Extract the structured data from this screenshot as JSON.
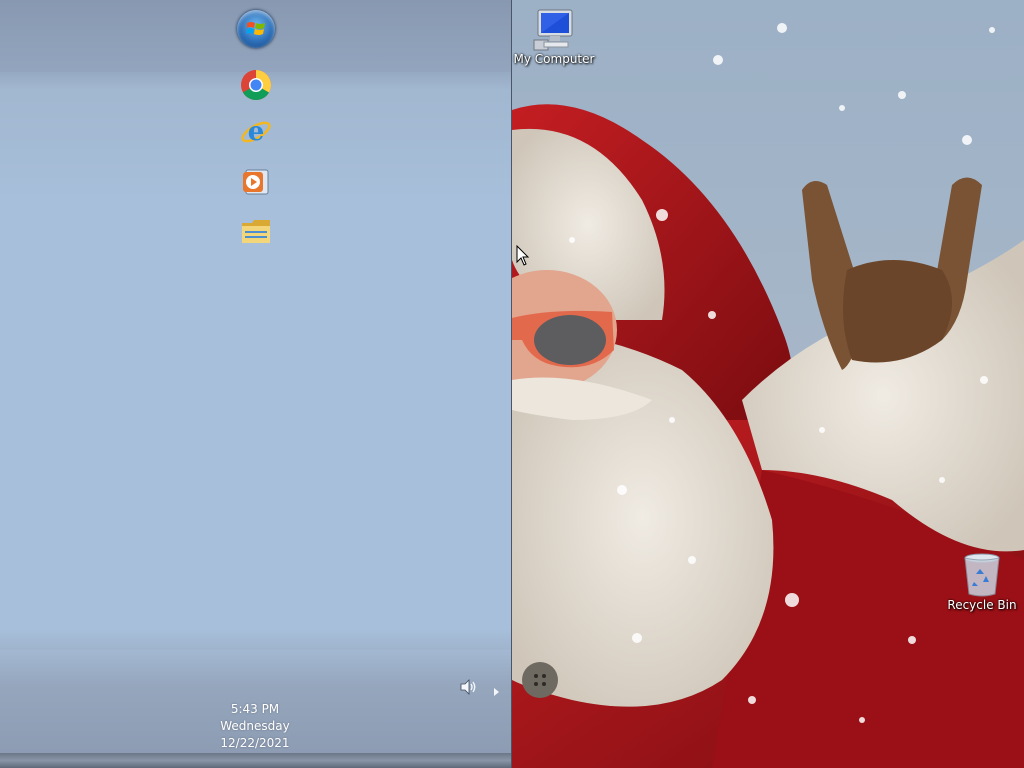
{
  "taskbar": {
    "pinned": [
      {
        "name": "Google Chrome",
        "icon": "chrome-icon"
      },
      {
        "name": "Internet Explorer",
        "icon": "internet-explorer-icon"
      },
      {
        "name": "Windows Media Player",
        "icon": "media-player-icon"
      },
      {
        "name": "Windows Explorer",
        "icon": "folder-icon"
      }
    ],
    "start_icon": "windows-orb-icon",
    "tray": {
      "volume_icon": "speaker-icon",
      "expand_icon": "chevron-right-icon"
    },
    "clock": {
      "time": "5:43 PM",
      "day": "Wednesday",
      "date": "12/22/2021"
    }
  },
  "desktop": {
    "icons": [
      {
        "label": "My Computer",
        "icon": "computer-icon"
      },
      {
        "label": "Recycle Bin",
        "icon": "recycle-bin-icon"
      }
    ],
    "wallpaper": "santa-wallpaper"
  },
  "colors": {
    "taskbar_bg": "#a7bfda",
    "santa_red": "#b3161c",
    "fur_white": "#e9e2d8"
  }
}
